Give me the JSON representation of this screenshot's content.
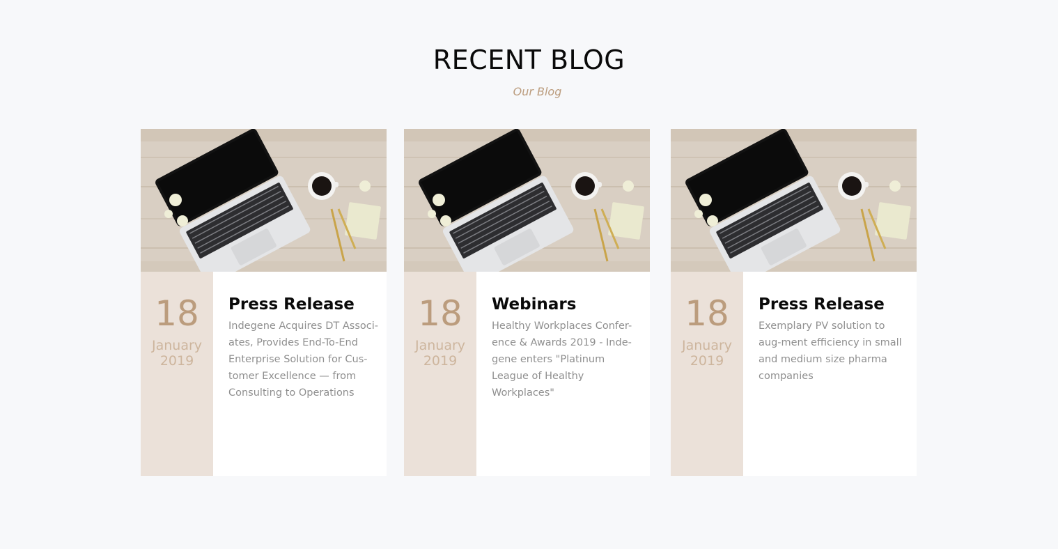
{
  "section": {
    "title": "RECENT BLOG",
    "subtitle": "Our Blog"
  },
  "colors": {
    "accent": "#bb9c7d",
    "date_bg": "#ebe1d9",
    "page_bg": "#f7f8fa"
  },
  "cards": [
    {
      "day": "18",
      "month": "January",
      "year": "2019",
      "category": "Press Release",
      "excerpt": "Indegene Acquires DT Associ-ates, Provides End-To-End Enterprise Solution for Cus-tomer Excellence — from Consulting to Operations",
      "image": "laptop-desk-photo"
    },
    {
      "day": "18",
      "month": "January",
      "year": "2019",
      "category": "Webinars",
      "excerpt": "Healthy Workplaces Confer-ence & Awards 2019 - Inde-gene enters \"Platinum League of Healthy Workplaces\"",
      "image": "laptop-desk-photo"
    },
    {
      "day": "18",
      "month": "January",
      "year": "2019",
      "category": "Press Release",
      "excerpt": "Exemplary PV solution to aug-ment efficiency in small and medium size pharma companies",
      "image": "laptop-desk-photo"
    }
  ]
}
